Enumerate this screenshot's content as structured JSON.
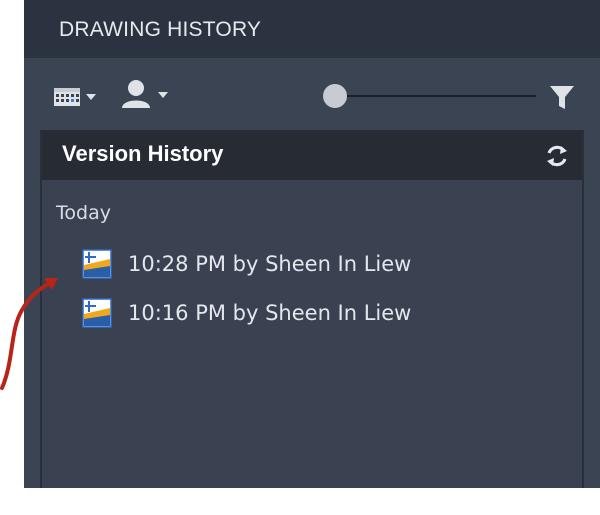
{
  "panel": {
    "title": "DRAWING HISTORY"
  },
  "toolbar": {
    "calendar_icon": "calendar-grid-icon",
    "user_icon": "user-icon",
    "filter_icon": "funnel-icon",
    "slider_level": 0
  },
  "version_history": {
    "title": "Version History",
    "refresh_icon": "refresh-icon",
    "groups": [
      {
        "label": "Today",
        "items": [
          {
            "label": "10:28 PM by Sheen In Liew",
            "icon": "drawing-file-icon"
          },
          {
            "label": "10:16 PM by Sheen In Liew",
            "icon": "drawing-file-icon"
          }
        ]
      }
    ]
  },
  "colors": {
    "panel_bg": "#3b4453",
    "header_bg": "#2c3340",
    "inner_header_bg": "#262b34",
    "annotation_arrow": "#b8231a"
  }
}
